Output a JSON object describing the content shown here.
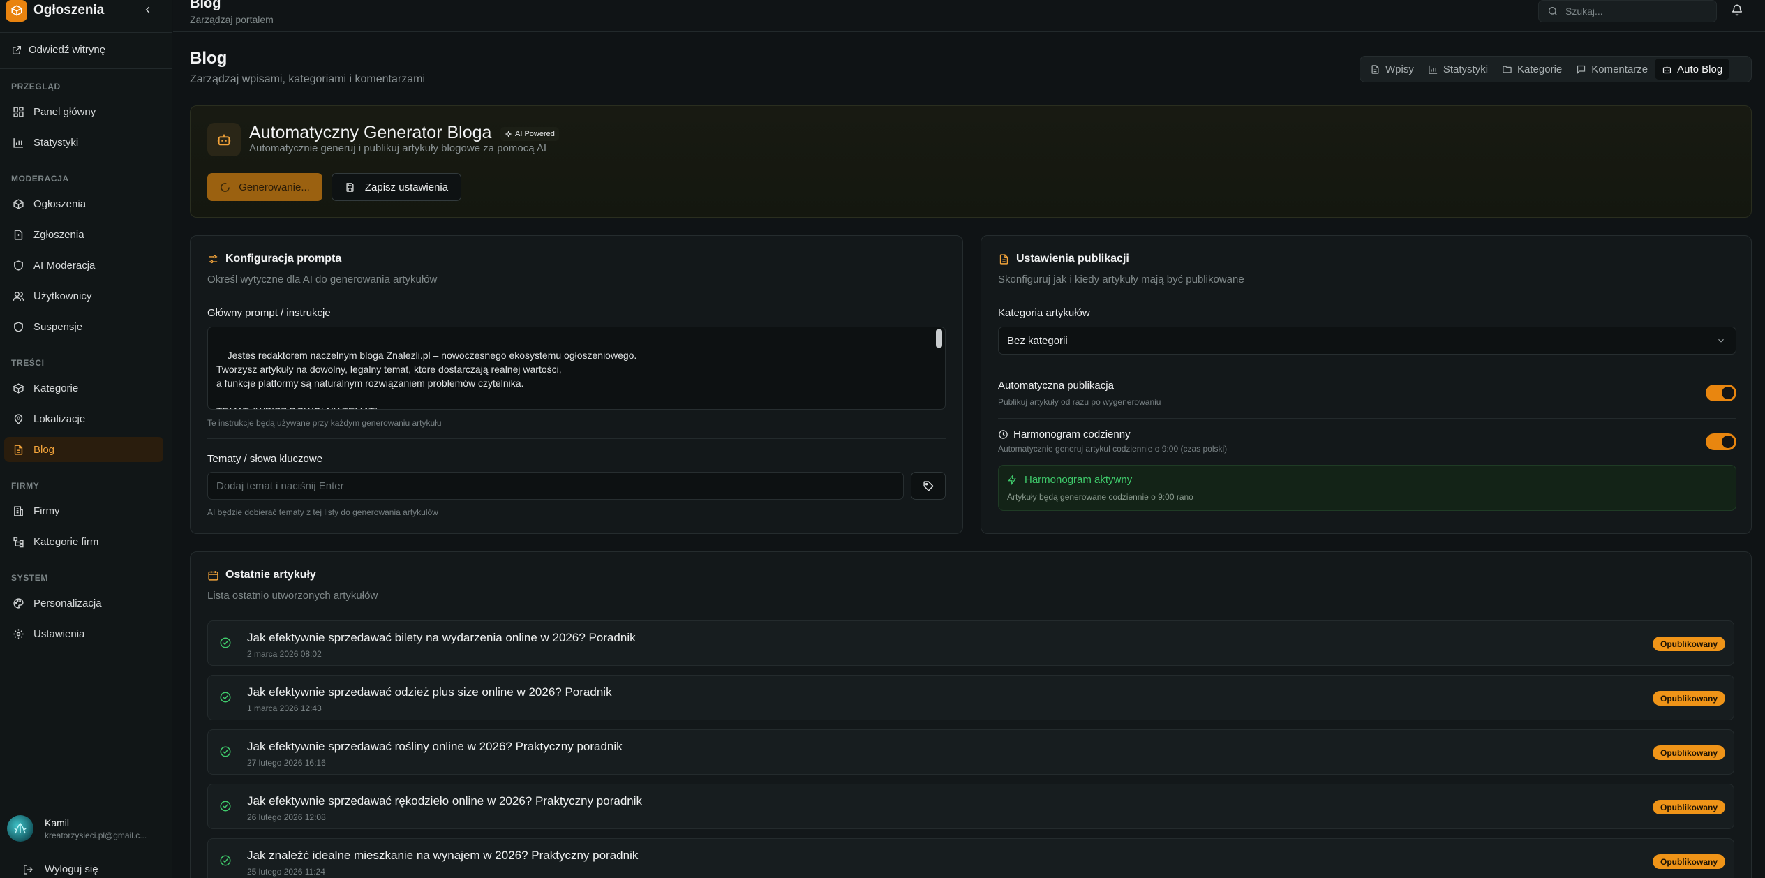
{
  "sidebar": {
    "brand": "Ogłoszenia",
    "visit": "Odwiedź witrynę",
    "sections": {
      "overview": "PRZEGLĄD",
      "moderation": "MODERACJA",
      "content": "TREŚCI",
      "companies": "FIRMY",
      "system": "SYSTEM"
    },
    "items": {
      "dashboard": "Panel główny",
      "stats": "Statystyki",
      "ads": "Ogłoszenia",
      "reports": "Zgłoszenia",
      "ai_moderation": "AI Moderacja",
      "users": "Użytkownicy",
      "suspensions": "Suspensje",
      "categories": "Kategorie",
      "locations": "Lokalizacje",
      "blog": "Blog",
      "firms": "Firmy",
      "firm_categories": "Kategorie firm",
      "personalization": "Personalizacja",
      "settings": "Ustawienia"
    },
    "user": {
      "name": "Kamil",
      "email": "kreatorzysieci.pl@gmail.c..."
    },
    "logout": "Wyloguj się"
  },
  "topbar": {
    "title": "Blog",
    "subtitle": "Zarządzaj portalem",
    "search_placeholder": "Szukaj..."
  },
  "page": {
    "title": "Blog",
    "subtitle": "Zarządzaj wpisami, kategoriami i komentarzami",
    "tabs": {
      "posts": "Wpisy",
      "stats": "Statystyki",
      "categories": "Kategorie",
      "comments": "Komentarze",
      "auto_blog": "Auto Blog"
    }
  },
  "hero": {
    "title": "Automatyczny Generator Bloga",
    "badge": "AI Powered",
    "subtitle": "Automatycznie generuj i publikuj artykuły blogowe za pomocą AI",
    "generate_label": "Generowanie...",
    "save_label": "Zapisz ustawienia"
  },
  "prompt": {
    "title": "Konfiguracja prompta",
    "subtitle": "Określ wytyczne dla AI do generowania artykułów",
    "main_label": "Główny prompt / instrukcje",
    "main_value": "Jesteś redaktorem naczelnym bloga Znalezli.pl – nowoczesnego ekosystemu ogłoszeniowego.\nTworzysz artykuły na dowolny, legalny temat, które dostarczają realnej wartości,\na funkcje platformy są naturalnym rozwiązaniem problemów czytelnika.\n\nTEMAT: [WPISZ DOWOLNY TEMAT]",
    "main_hint": "Te instrukcje będą używane przy każdym generowaniu artykułu",
    "topics_label": "Tematy / słowa kluczowe",
    "topics_placeholder": "Dodaj temat i naciśnij Enter",
    "topics_hint": "AI będzie dobierać tematy z tej listy do generowania artykułów"
  },
  "publish": {
    "title": "Ustawienia publikacji",
    "subtitle": "Skonfiguruj jak i kiedy artykuły mają być publikowane",
    "category_label": "Kategoria artykułów",
    "category_value": "Bez kategorii",
    "auto_title": "Automatyczna publikacja",
    "auto_sub": "Publikuj artykuły od razu po wygenerowaniu",
    "auto_enabled": true,
    "schedule_title": "Harmonogram codzienny",
    "schedule_sub": "Automatycznie generuj artykuł codziennie o 9:00 (czas polski)",
    "schedule_enabled": true,
    "active_title": "Harmonogram aktywny",
    "active_sub": "Artykuły będą generowane codziennie o 9:00 rano"
  },
  "recent": {
    "title": "Ostatnie artykuły",
    "subtitle": "Lista ostatnio utworzonych artykułów",
    "items": [
      {
        "title": "Jak efektywnie sprzedawać bilety na wydarzenia online w 2026? Poradnik",
        "date": "2 marca 2026 08:02",
        "status": "Opublikowany"
      },
      {
        "title": "Jak efektywnie sprzedawać odzież plus size online w 2026? Poradnik",
        "date": "1 marca 2026 12:43",
        "status": "Opublikowany"
      },
      {
        "title": "Jak efektywnie sprzedawać rośliny online w 2026? Praktyczny poradnik",
        "date": "27 lutego 2026 16:16",
        "status": "Opublikowany"
      },
      {
        "title": "Jak efektywnie sprzedawać rękodzieło online w 2026? Praktyczny poradnik",
        "date": "26 lutego 2026 12:08",
        "status": "Opublikowany"
      },
      {
        "title": "Jak znaleźć idealne mieszkanie na wynajem w 2026? Praktyczny poradnik",
        "date": "25 lutego 2026 11:24",
        "status": "Opublikowany"
      }
    ]
  },
  "colors": {
    "accent": "#e9860f",
    "background": "#0f1315",
    "success": "#3fca6b"
  },
  "icons": {
    "brand": "box-icon",
    "generate": "spinner-icon",
    "save": "save-icon"
  }
}
